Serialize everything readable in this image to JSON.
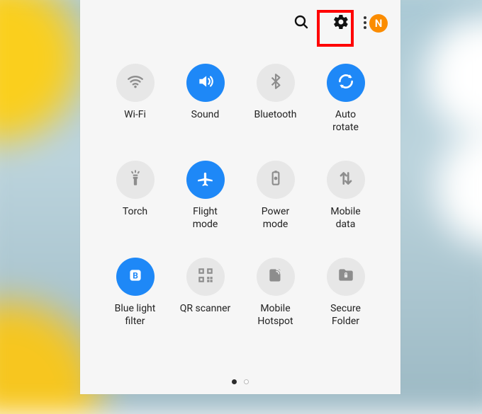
{
  "colors": {
    "accent": "#1e88f7",
    "tile_off_bg": "#e7e7e7",
    "tile_off_fg": "#8d8d8d",
    "avatar": "#fb8c00",
    "highlight": "#ff0000"
  },
  "header": {
    "search_icon": "search-icon",
    "settings_icon": "gear-icon",
    "settings_highlighted": true,
    "menu_icon": "more-vert-icon",
    "avatar_letter": "N"
  },
  "tiles": [
    {
      "id": "wifi",
      "label": "Wi-Fi",
      "active": false,
      "icon": "wifi"
    },
    {
      "id": "sound",
      "label": "Sound",
      "active": true,
      "icon": "volume"
    },
    {
      "id": "bluetooth",
      "label": "Bluetooth",
      "active": false,
      "icon": "bluetooth"
    },
    {
      "id": "autorotate",
      "label": "Auto\nrotate",
      "active": true,
      "icon": "rotate"
    },
    {
      "id": "torch",
      "label": "Torch",
      "active": false,
      "icon": "torch"
    },
    {
      "id": "flight",
      "label": "Flight\nmode",
      "active": true,
      "icon": "airplane"
    },
    {
      "id": "power",
      "label": "Power\nmode",
      "active": false,
      "icon": "battery"
    },
    {
      "id": "data",
      "label": "Mobile\ndata",
      "active": false,
      "icon": "updown"
    },
    {
      "id": "bluelight",
      "label": "Blue light\nfilter",
      "active": true,
      "icon": "bluelight"
    },
    {
      "id": "qr",
      "label": "QR scanner",
      "active": false,
      "icon": "qr"
    },
    {
      "id": "hotspot",
      "label": "Mobile\nHotspot",
      "active": false,
      "icon": "hotspot"
    },
    {
      "id": "secure",
      "label": "Secure\nFolder",
      "active": false,
      "icon": "folderlock"
    }
  ],
  "pager": {
    "pages": 2,
    "current": 1
  }
}
